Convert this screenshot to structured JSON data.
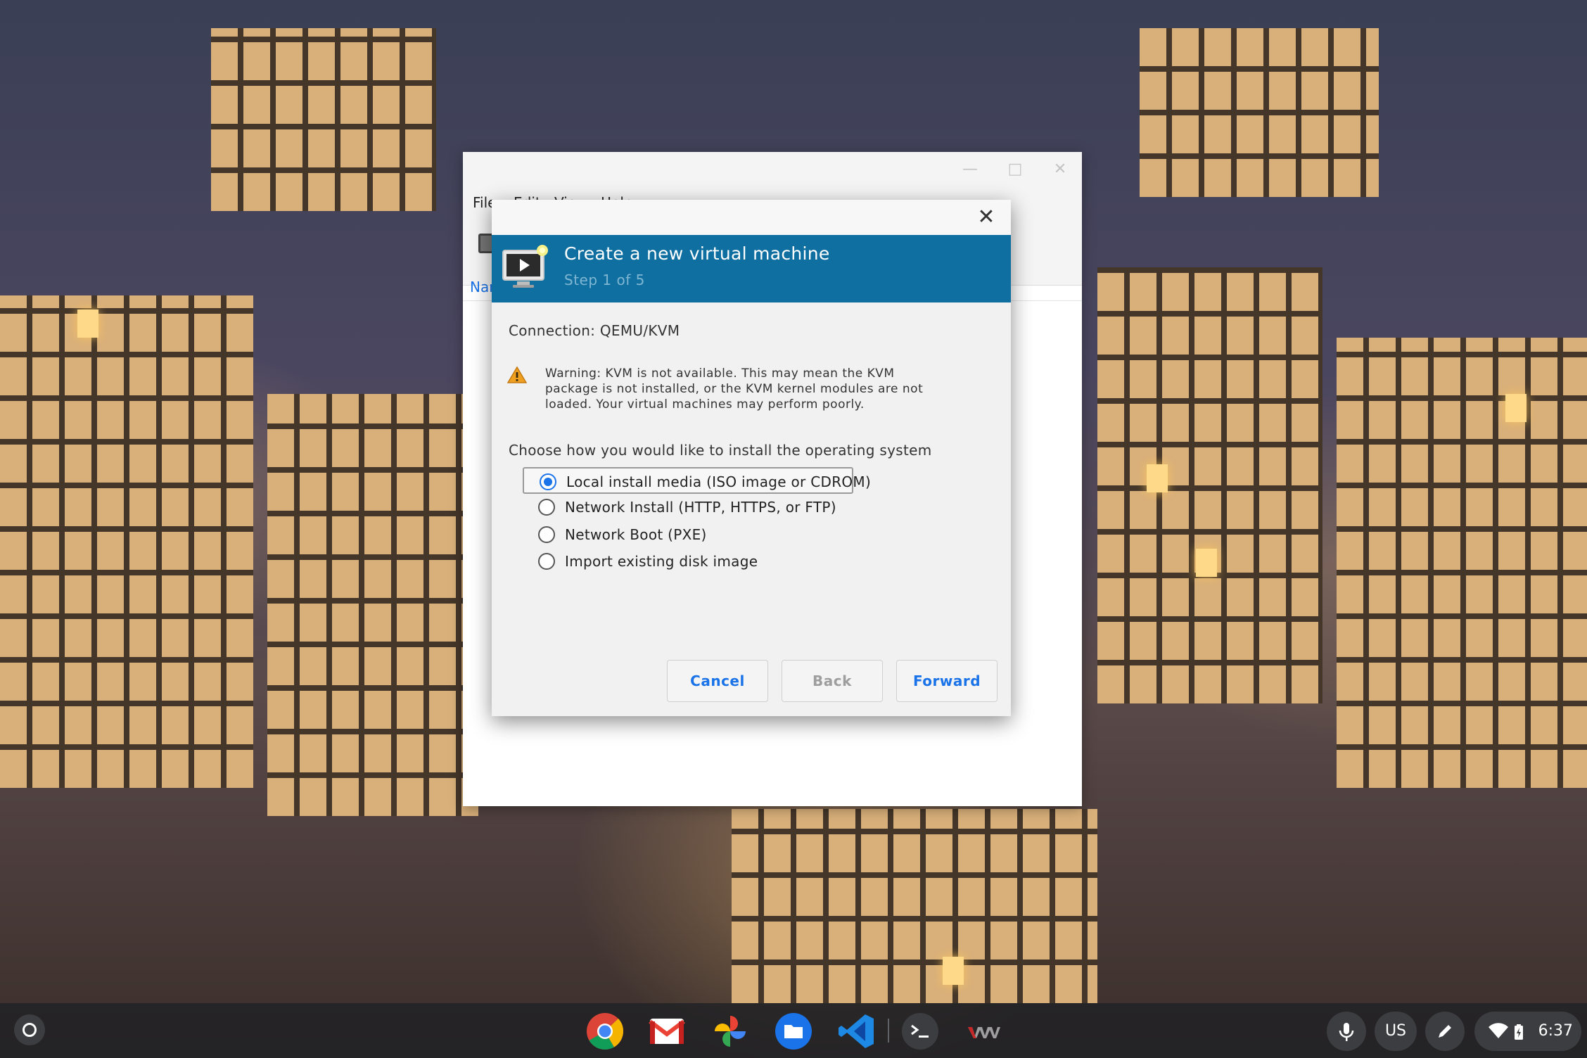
{
  "background_window": {
    "menu": [
      "File",
      "Edit",
      "View",
      "Help"
    ],
    "list_header": "Name"
  },
  "dialog": {
    "title": "Create a new virtual machine",
    "step": "Step 1 of 5",
    "connection": "Connection:  QEMU/KVM",
    "warning": "Warning: KVM is not available. This may mean the KVM package is not installed, or the KVM kernel modules are not loaded. Your virtual machines may perform poorly.",
    "choose_label": "Choose how you would like to install the operating system",
    "options": [
      {
        "label": "Local install media (ISO image or CDROM)",
        "selected": true
      },
      {
        "label": "Network Install (HTTP, HTTPS, or FTP)",
        "selected": false
      },
      {
        "label": "Network Boot (PXE)",
        "selected": false
      },
      {
        "label": "Import existing disk image",
        "selected": false
      }
    ],
    "buttons": {
      "cancel": "Cancel",
      "back": "Back",
      "forward": "Forward"
    },
    "colors": {
      "banner": "#0f6fa1",
      "accent": "#1a73e8"
    }
  },
  "shelf": {
    "apps": [
      "chrome-icon",
      "gmail-icon",
      "photos-icon",
      "files-icon",
      "vscode-icon",
      "terminal-icon",
      "virt-manager-icon"
    ],
    "status": {
      "input_method": "US",
      "time": "6:37"
    }
  }
}
